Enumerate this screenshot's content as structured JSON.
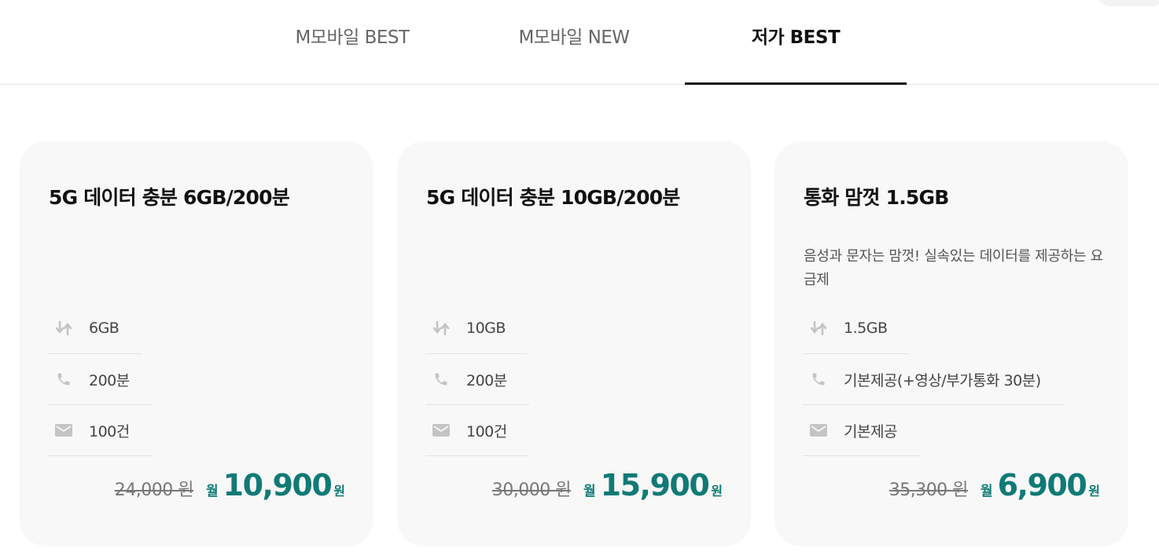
{
  "tabs": [
    {
      "label": "M모바일 BEST",
      "active": false
    },
    {
      "label": "M모바일 NEW",
      "active": false
    },
    {
      "label": "저가 BEST",
      "active": true
    }
  ],
  "cards": [
    {
      "title": "5G 데이터 충분 6GB/200분",
      "description": "",
      "specs": {
        "data": "6GB",
        "call": "200분",
        "sms": "100건"
      },
      "original_price": "24,000 원",
      "per_label": "월",
      "price": "10,900",
      "currency": "원"
    },
    {
      "title": "5G 데이터 충분 10GB/200분",
      "description": "",
      "specs": {
        "data": "10GB",
        "call": "200분",
        "sms": "100건"
      },
      "original_price": "30,000 원",
      "per_label": "월",
      "price": "15,900",
      "currency": "원"
    },
    {
      "title": "통화 맘껏 1.5GB",
      "description": "음성과 문자는 맘껏! 실속있는 데이터를 제공하는 요금제",
      "specs": {
        "data": "1.5GB",
        "call": "기본제공(+영상/부가통화 30분)",
        "sms": "기본제공"
      },
      "original_price": "35,300 원",
      "per_label": "월",
      "price": "6,900",
      "currency": "원"
    }
  ],
  "icons": {
    "data": "data-transfer-icon",
    "call": "phone-icon",
    "sms": "mail-icon"
  },
  "colors": {
    "accent": "#117a76",
    "card_bg": "#f8f8f8",
    "icon": "#c4c4c4"
  }
}
